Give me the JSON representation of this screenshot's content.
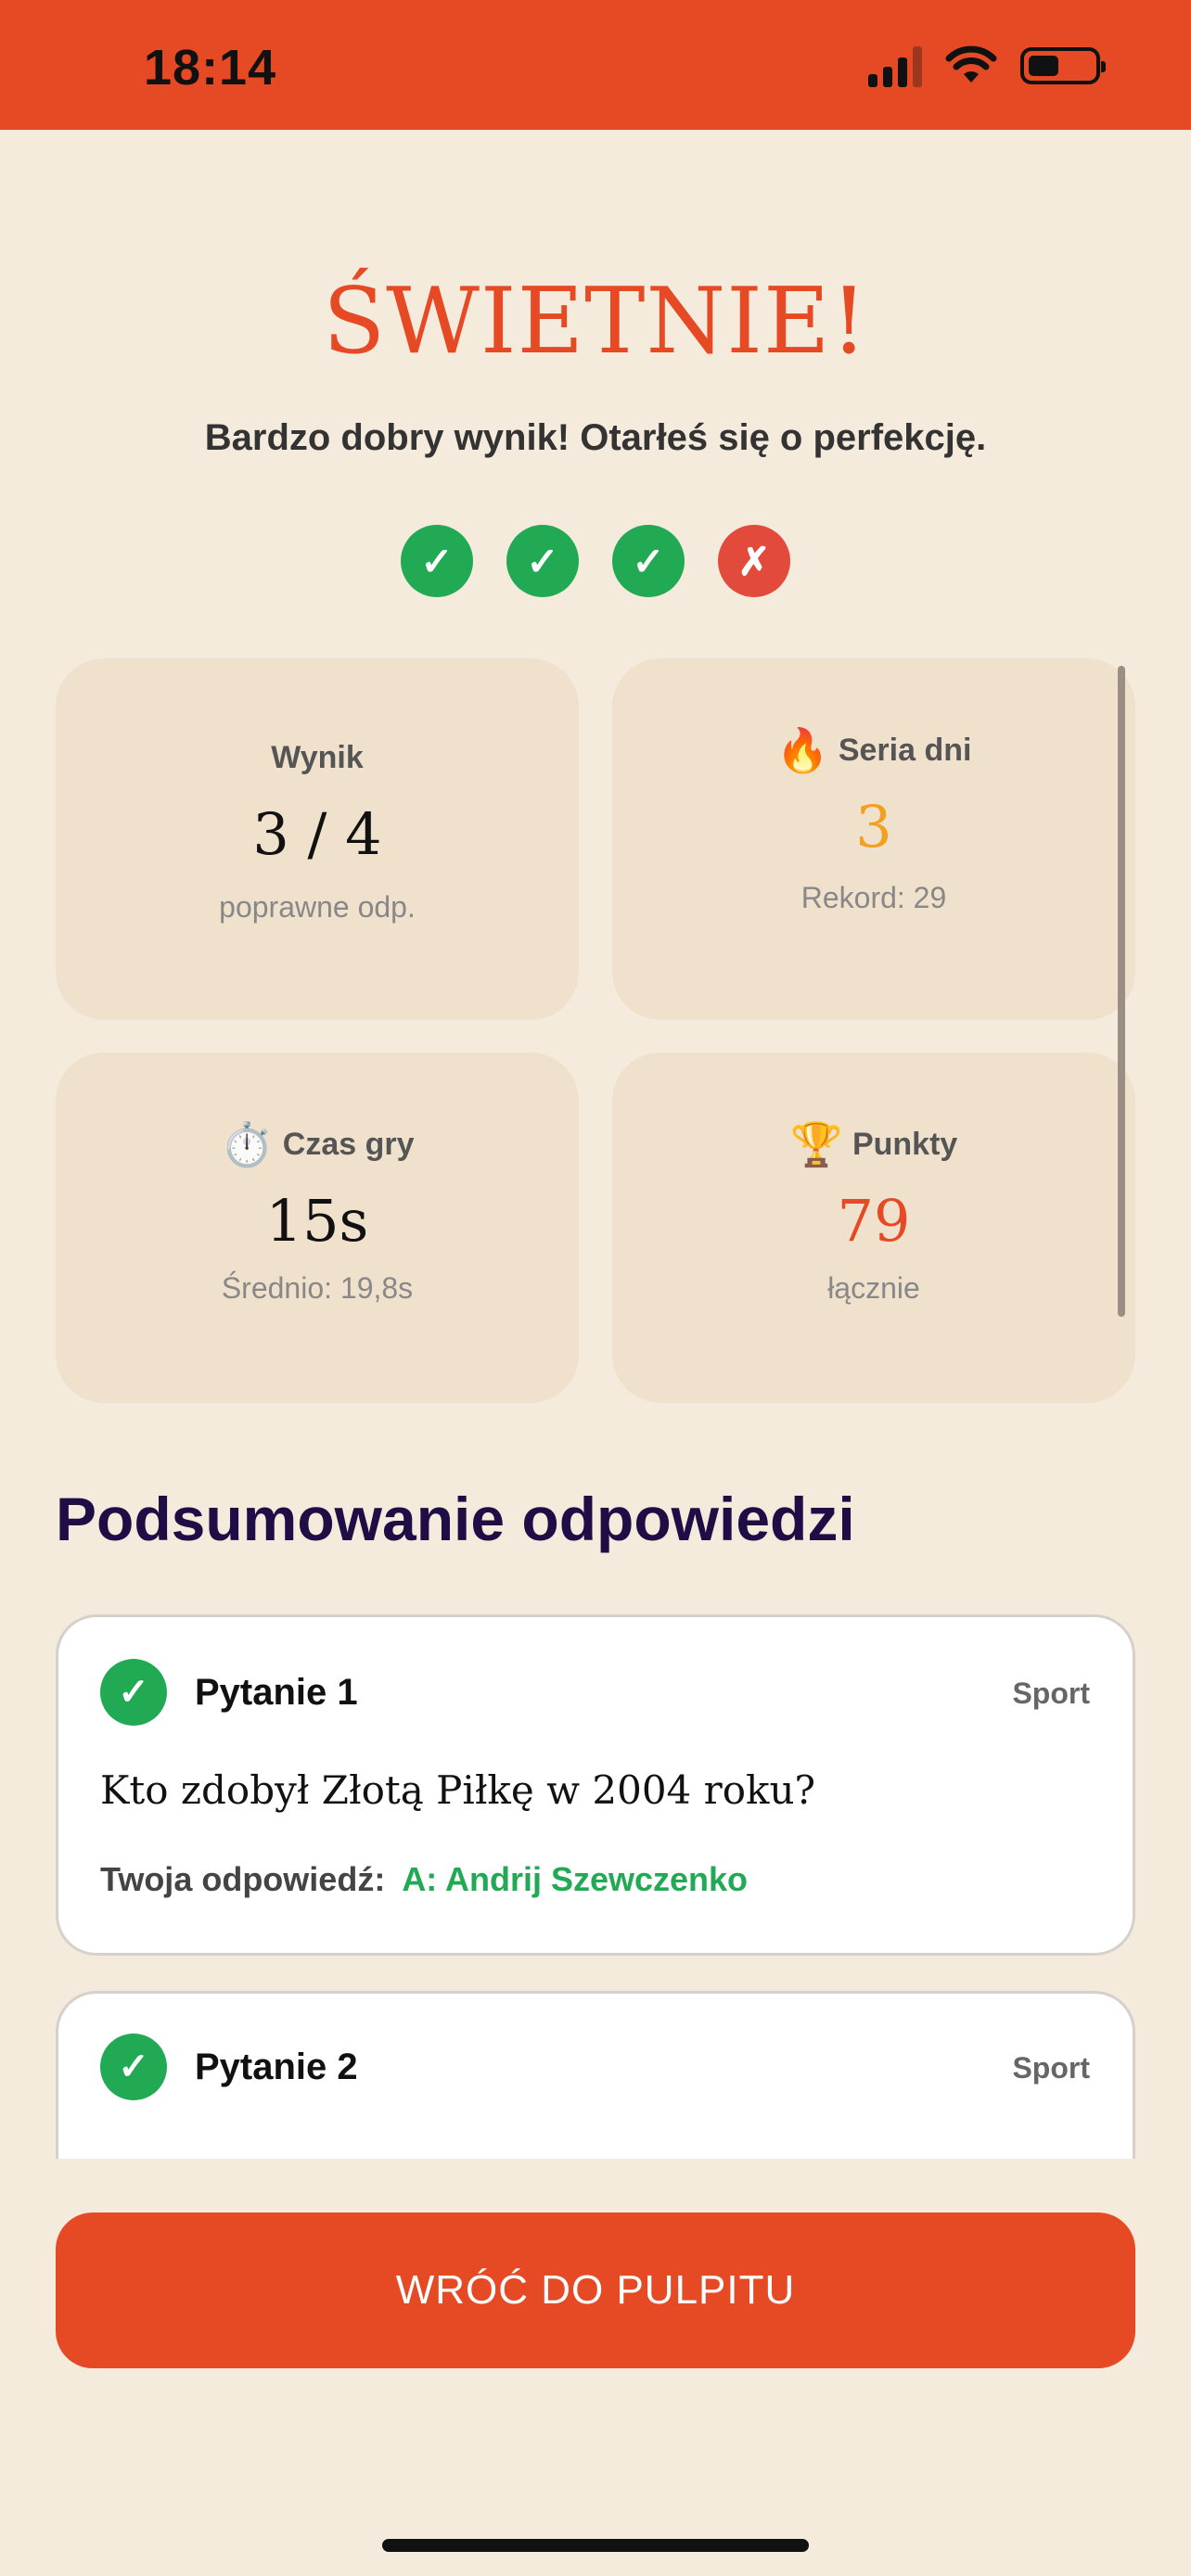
{
  "status_bar": {
    "time": "18:14",
    "battery_level": 0.45
  },
  "result": {
    "headline": "ŚWIETNIE!",
    "subtitle": "Bardzo dobry wynik! Otarłeś się o perfekcję.",
    "answers": [
      {
        "correct": true,
        "glyph": "✓"
      },
      {
        "correct": true,
        "glyph": "✓"
      },
      {
        "correct": true,
        "glyph": "✓"
      },
      {
        "correct": false,
        "glyph": "✗"
      }
    ]
  },
  "stats": {
    "score": {
      "label": "Wynik",
      "value": "3 / 4",
      "sub": "poprawne odp."
    },
    "streak": {
      "icon": "🔥",
      "label": "Seria dni",
      "value": "3",
      "sub": "Rekord: 29",
      "accent": "#f3a021"
    },
    "time": {
      "icon": "⏱️",
      "label": "Czas gry",
      "value": "15s",
      "sub": "Średnio: 19,8s"
    },
    "points": {
      "icon": "🏆",
      "label": "Punkty",
      "value": "79",
      "sub": "łącznie",
      "accent": "#e64a25"
    }
  },
  "summary": {
    "title": "Podsumowanie odpowiedzi",
    "questions": [
      {
        "number": "Pytanie 1",
        "category": "Sport",
        "text": "Kto zdobył Złotą Piłkę w 2004 roku?",
        "answer_label": "Twoja odpowiedź:",
        "answer": "A: Andrij Szewczenko",
        "correct": true
      },
      {
        "number": "Pytanie 2",
        "category": "Sport",
        "correct": true
      }
    ]
  },
  "cta": {
    "label": "WRÓĆ DO PULPITU"
  },
  "colors": {
    "brand": "#e64a25",
    "background": "#f5ebdd",
    "correct": "#22a954",
    "wrong": "#e24a3b",
    "heading": "#1f0e45"
  }
}
